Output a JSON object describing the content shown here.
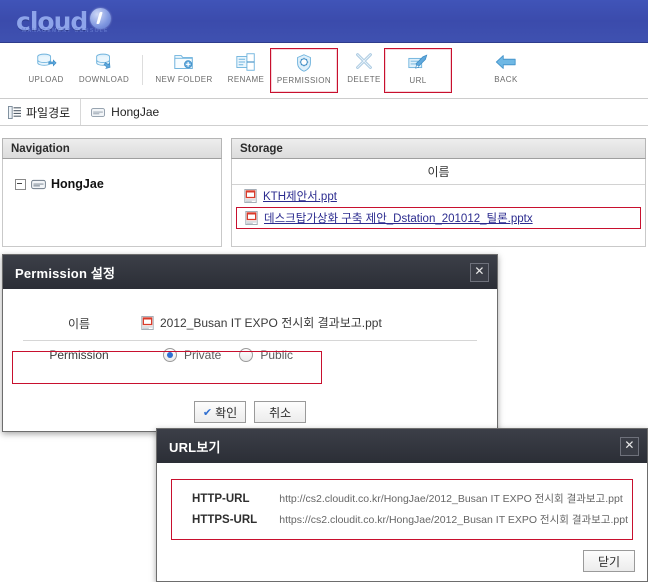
{
  "brand": {
    "name": "cloud",
    "tagline": "MANAGEMENT CONSOLE"
  },
  "toolbar": {
    "items": [
      {
        "label": "UPLOAD",
        "icon": "upload-icon",
        "highlighted": false
      },
      {
        "label": "DOWNLOAD",
        "icon": "download-icon",
        "highlighted": false
      },
      {
        "label": "NEW FOLDER",
        "icon": "new-folder-icon",
        "highlighted": false
      },
      {
        "label": "RENAME",
        "icon": "rename-icon",
        "highlighted": false
      },
      {
        "label": "PERMISSION",
        "icon": "permission-icon",
        "highlighted": true
      },
      {
        "label": "DELETE",
        "icon": "delete-icon",
        "highlighted": false
      },
      {
        "label": "URL",
        "icon": "url-icon",
        "highlighted": true
      },
      {
        "label": "BACK",
        "icon": "back-icon",
        "highlighted": false
      }
    ]
  },
  "path": {
    "label": "파일경로",
    "value": "HongJae"
  },
  "navigation": {
    "title": "Navigation",
    "root": "HongJae"
  },
  "storage": {
    "title": "Storage",
    "column_header": "이름",
    "files": [
      {
        "name": "KTH제안서.ppt",
        "highlighted": false
      },
      {
        "name": "데스크탑가상화 구축 제안_Dstation_201012_틸론.pptx",
        "highlighted": true
      }
    ]
  },
  "permission_dialog": {
    "title": "Permission 설정",
    "close_label": "✕",
    "name_label": "이름",
    "name_value": "2012_Busan IT EXPO 전시회 결과보고.ppt",
    "permission_label": "Permission",
    "options": [
      {
        "label": "Private",
        "selected": true
      },
      {
        "label": "Public",
        "selected": false
      }
    ],
    "confirm_label": "확인",
    "cancel_label": "취소"
  },
  "url_dialog": {
    "title": "URL보기",
    "close_label": "✕",
    "rows": [
      {
        "key": "HTTP-URL",
        "value": "http://cs2.cloudit.co.kr/HongJae/2012_Busan IT EXPO 전시회 결과보고.ppt"
      },
      {
        "key": "HTTPS-URL",
        "value": "https://cs2.cloudit.co.kr/HongJae/2012_Busan IT EXPO 전시회 결과보고.ppt"
      }
    ],
    "close_button_label": "닫기"
  },
  "colors": {
    "brand_bar": "#3f51b0",
    "highlight_outline": "#c8102e",
    "dialog_title_bar": "#2f323a",
    "link": "#2b2b8f"
  }
}
